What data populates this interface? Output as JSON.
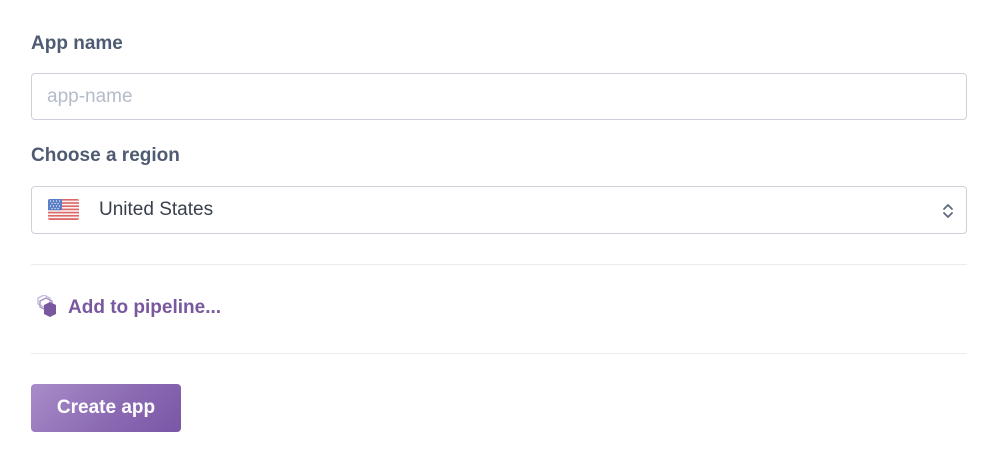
{
  "app_name": {
    "label": "App name",
    "value": "",
    "placeholder": "app-name"
  },
  "region": {
    "label": "Choose a region",
    "selected": "United States",
    "flag_icon": "us-flag-icon"
  },
  "pipeline": {
    "label": "Add to pipeline...",
    "icon": "pipeline-hexagon-icon"
  },
  "actions": {
    "create_label": "Create app"
  },
  "colors": {
    "accent": "#79589f",
    "label": "#4f5b72",
    "border": "#ccd1da",
    "button_gradient_start": "#a98cc9",
    "button_gradient_end": "#7a56a6"
  }
}
